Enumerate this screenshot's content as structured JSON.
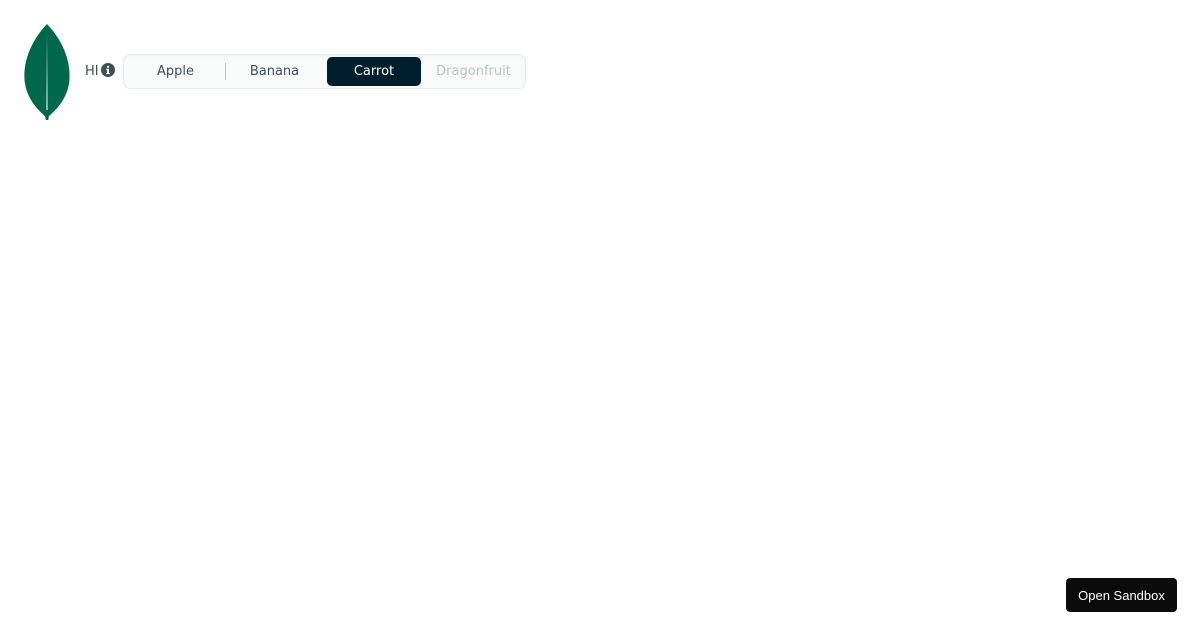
{
  "label": {
    "text": "HI",
    "icon": "info-icon"
  },
  "segmented_control": {
    "options": [
      {
        "label": "Apple",
        "state": "default"
      },
      {
        "label": "Banana",
        "state": "default"
      },
      {
        "label": "Carrot",
        "state": "selected"
      },
      {
        "label": "Dragonfruit",
        "state": "disabled"
      }
    ],
    "selected": "Carrot"
  },
  "sandbox": {
    "button_label": "Open Sandbox"
  },
  "colors": {
    "brand_green": "#00684a",
    "selected_bg": "#001e2b",
    "text": "#3d4f58",
    "disabled_text": "#b8c4c2"
  }
}
